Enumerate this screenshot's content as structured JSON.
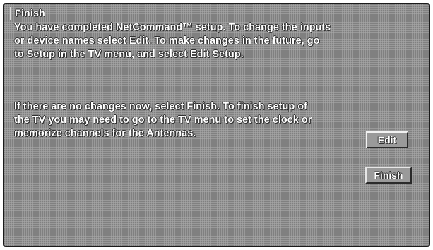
{
  "dialog": {
    "title": "Finish",
    "paragraph_1": "You have completed NetCommand™ setup.  To change the inputs\nor device names select Edit.  To make changes in the future, go\nto Setup in the TV menu, and select Edit Setup.",
    "paragraph_2": "If there are no changes now, select Finish.  To finish setup of\nthe TV you may need to go to the TV menu to set the clock or\nmemorize channels for the Antennas."
  },
  "buttons": {
    "edit_label": "Edit",
    "finish_label": "Finish"
  },
  "colors": {
    "background": "#8f8f8f",
    "text": "#ffffff",
    "border": "#1a1a1a"
  }
}
